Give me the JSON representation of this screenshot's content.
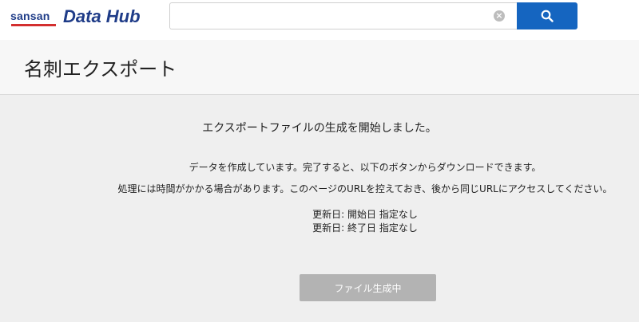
{
  "header": {
    "logo_brand": "sansan",
    "logo_product": "Data Hub",
    "search": {
      "value": "",
      "placeholder": ""
    },
    "clear_icon_glyph": "×",
    "colors": {
      "brand": "#1f3c88",
      "accent": "#d32f2f",
      "search_button": "#1565c0"
    }
  },
  "page": {
    "title": "名刺エクスポート"
  },
  "export": {
    "message_main": "エクスポートファイルの生成を開始しました。",
    "message_1": "データを作成しています。完了すると、以下のボタンからダウンロードできます。",
    "message_2": "処理には時間がかかる場合があります。このページのURLを控えておき、後から同じURLにアクセスしてください。",
    "date_start": "更新日: 開始日 指定なし",
    "date_end": "更新日: 終了日 指定なし",
    "button_label": "ファイル生成中"
  }
}
